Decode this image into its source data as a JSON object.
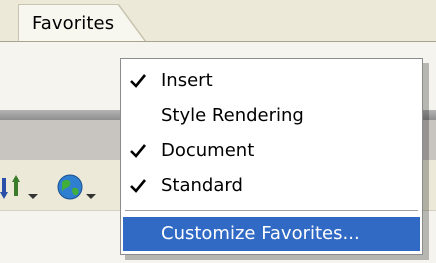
{
  "tab": {
    "label": "Favorites"
  },
  "toolbar": {
    "icons": [
      "sort-order-icon",
      "globe-icon"
    ]
  },
  "menu": {
    "items": [
      {
        "label": "Insert",
        "checked": true
      },
      {
        "label": "Style Rendering",
        "checked": false
      },
      {
        "label": "Document",
        "checked": true
      },
      {
        "label": "Standard",
        "checked": true
      }
    ],
    "customize_label": "Customize Favorites..."
  },
  "colors": {
    "selection": "#316ac5",
    "menu_background": "#ffffff",
    "panel_background": "#ece9d8"
  }
}
